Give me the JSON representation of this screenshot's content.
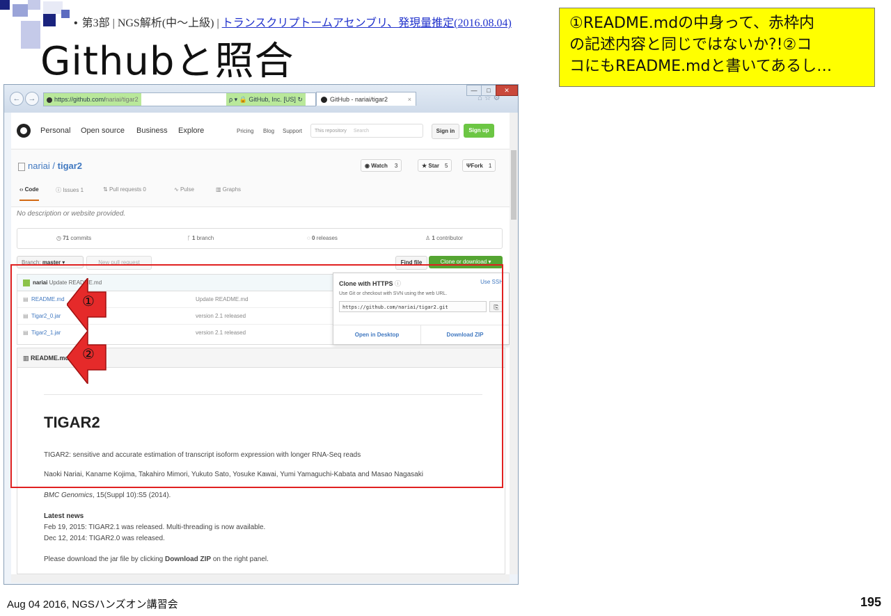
{
  "slide": {
    "breadcrumb_bullet": "•",
    "breadcrumb_part": "第3部 | NGS解析(中〜上級) | ",
    "breadcrumb_link": "トランスクリプトームアセンブリ、発現量推定(2016.08.04)",
    "title": "Githubと照合",
    "callout_line1": "①README.mdの中身って、赤枠内",
    "callout_line2": "の記述内容と同じではないか?!②コ",
    "callout_line3": "コにもREADME.mdと書いてあるし…",
    "footer": "Aug 04 2016, NGSハンズオン講習会",
    "page_number": "195",
    "marker1": "①",
    "marker2": "②"
  },
  "browser": {
    "url_secure": "https://github.com/",
    "url_rest": "nariai/tigar2",
    "search_hint": "ρ ▾ 🔒 GitHub, Inc. [US] ↻",
    "tab_title": "GitHub - nariai/tigar2",
    "tab_close": "×",
    "back": "←",
    "forward": "→",
    "home_icons": "⌂ ☆ ⚙",
    "win_min": "—",
    "win_max": "□",
    "win_close": "✕"
  },
  "github": {
    "nav": [
      "Personal",
      "Open source",
      "Business",
      "Explore"
    ],
    "nav_small": [
      "Pricing",
      "Blog",
      "Support"
    ],
    "search_scope": "This repository",
    "search_placeholder": "Search",
    "sign_in": "Sign in",
    "sign_up": "Sign up",
    "repo_owner": "nariai",
    "repo_sep": " / ",
    "repo_name": "tigar2",
    "watch_label": "Watch",
    "watch_count": "3",
    "star_label": "Star",
    "star_count": "5",
    "fork_label": "Fork",
    "fork_count": "1",
    "tabs": [
      "Code",
      "Issues",
      "Pull requests",
      "Pulse",
      "Graphs"
    ],
    "issues_count": "1",
    "pr_count": "0",
    "description": "No description or website provided.",
    "commits": "71",
    "commits_label": "commits",
    "branches": "1",
    "branches_label": "branch",
    "releases": "0",
    "releases_label": "releases",
    "contributors": "1",
    "contributors_label": "contributor",
    "branch_prefix": "Branch:",
    "branch_name": "master",
    "new_pr": "New pull request",
    "find_file": "Find file",
    "clone_download": "Clone or download",
    "last_commit_user": "nariai",
    "last_commit_msg": "Update README.md",
    "files": [
      {
        "name": "README.md",
        "message": "Update README.md"
      },
      {
        "name": "Tigar2_0.jar",
        "message": "version 2.1 released"
      },
      {
        "name": "Tigar2_1.jar",
        "message": "version 2.1 released"
      }
    ],
    "clone": {
      "title": "Clone with HTTPS",
      "use_ssh": "Use SSH",
      "description": "Use Git or checkout with SVN using the web URL.",
      "url": "https://github.com/nariai/tigar2.git",
      "open_desktop": "Open in Desktop",
      "download_zip": "Download ZIP"
    },
    "readme": {
      "header": "README.md",
      "h1": "TIGAR2",
      "line1": "TIGAR2: sensitive and accurate estimation of transcript isoform expression with longer RNA-Seq reads",
      "authors": "Naoki Nariai, Kaname Kojima, Takahiro Mimori, Yukuto Sato, Yosuke Kawai, Yumi Yamaguchi-Kabata and Masao Nagasaki",
      "journal": "BMC Genomics",
      "citation": ", 15(Suppl 10):S5 (2014).",
      "news_title": "Latest news",
      "news1": "Feb 19, 2015: TIGAR2.1 was released. Multi-threading is now available.",
      "news2": "Dec 12, 2014: TIGAR2.0 was released.",
      "download_pre": "Please download the jar file by clicking ",
      "download_bold": "Download ZIP",
      "download_post": " on the right panel."
    }
  },
  "colors": {
    "callout": "#ffff00",
    "red_frame": "#e02020",
    "gh_link": "#4078c0",
    "gh_green": "#6cc644"
  }
}
